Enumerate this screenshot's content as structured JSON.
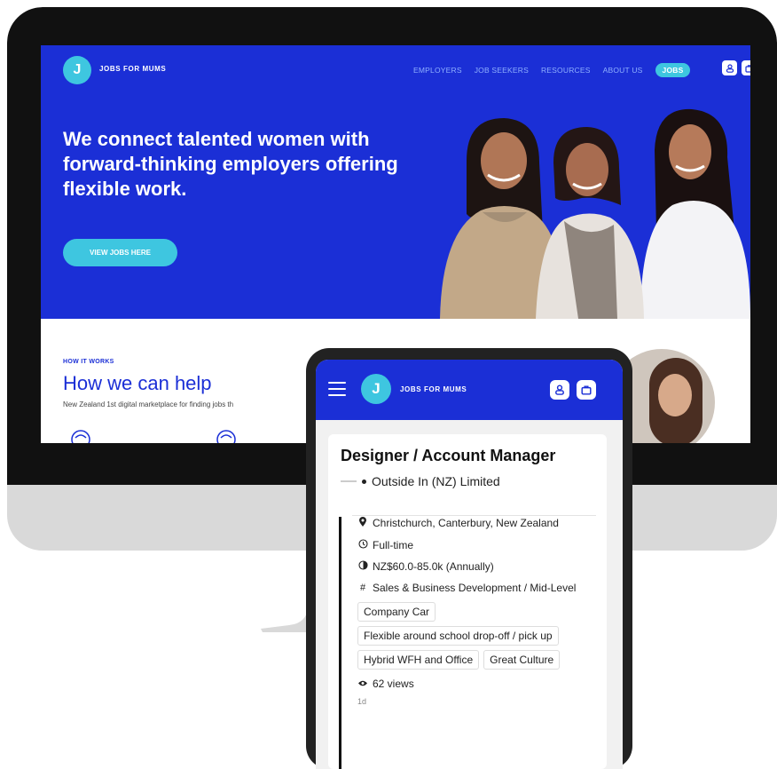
{
  "desktop": {
    "logo_letter": "J",
    "brand": "JOBS FOR MUMS",
    "nav": [
      "EMPLOYERS",
      "JOB SEEKERS",
      "RESOURCES",
      "ABOUT US"
    ],
    "nav_jobs": "JOBS",
    "headline": "We connect talented women with forward-thinking employers offering flexible work.",
    "cta": "VIEW JOBS HERE",
    "how_eyebrow": "HOW IT WORKS",
    "how_title": "How we can help",
    "how_sub": "New Zealand 1st digital marketplace for finding jobs th"
  },
  "tablet": {
    "logo_letter": "J",
    "brand": "JOBS FOR MUMS",
    "job": {
      "title": "Designer / Account Manager",
      "company": "Outside In (NZ) Limited",
      "location": "Christchurch, Canterbury, New Zealand",
      "type": "Full-time",
      "salary": "NZ$60.0-85.0k (Annually)",
      "category": "Sales & Business Development / Mid-Level",
      "tags": [
        "Company Car",
        "Flexible around school drop-off / pick up",
        "Hybrid WFH and Office",
        "Great Culture"
      ],
      "views": "62 views",
      "age": "1d"
    }
  },
  "colors": {
    "brand_blue": "#1b2fd6",
    "accent_cyan": "#3ec6e0",
    "bezel": "#111111"
  },
  "icons": [
    "user-icon",
    "briefcase-icon",
    "menu-icon",
    "location-pin-icon",
    "clock-icon",
    "salary-icon",
    "hash-icon",
    "eye-icon"
  ]
}
